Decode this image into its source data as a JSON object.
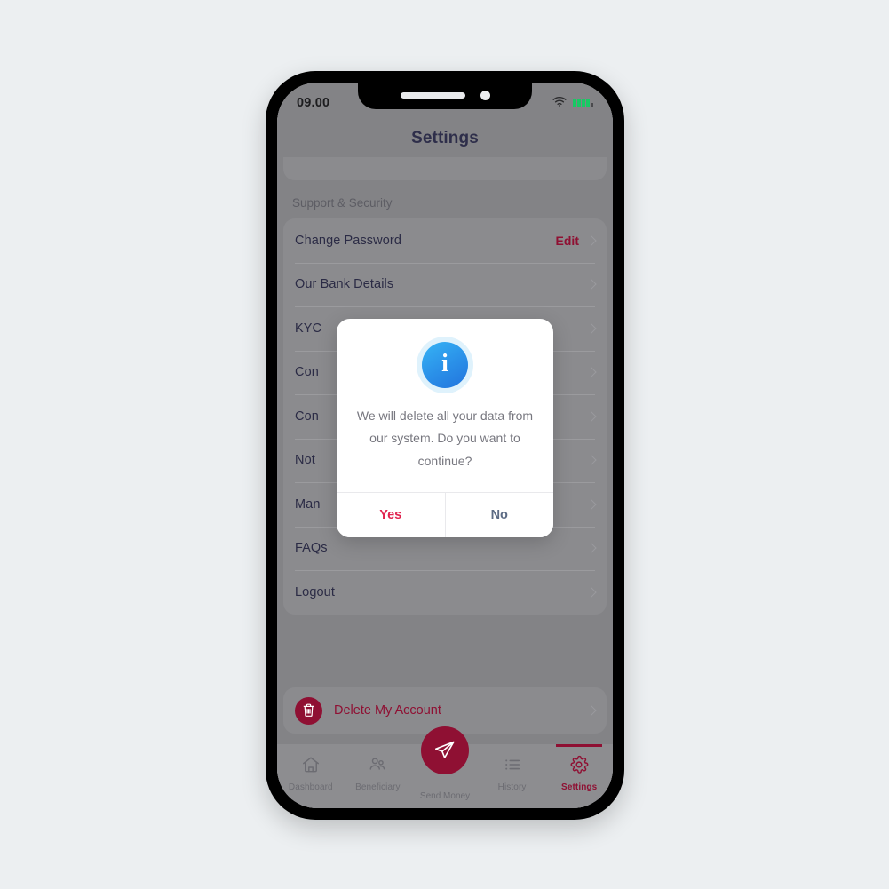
{
  "page": {
    "background_color": "#eceff1"
  },
  "phone": {
    "status_bar": {
      "time": "09.00",
      "wifi_icon": "wifi-icon",
      "battery_icon": "battery-icon",
      "battery_color": "#18c964"
    }
  },
  "header": {
    "title": "Settings"
  },
  "content": {
    "section_title": "Support & Security",
    "rows": [
      {
        "label": "Change Password",
        "action": "Edit",
        "chevron": "chevron-right-icon"
      },
      {
        "label": "Our Bank Details",
        "action": "",
        "chevron": "chevron-right-icon"
      },
      {
        "label": "KYC",
        "action": "",
        "chevron": "chevron-right-icon"
      },
      {
        "label": "Con",
        "action": "",
        "chevron": "chevron-right-icon"
      },
      {
        "label": "Con",
        "action": "",
        "chevron": "chevron-right-icon"
      },
      {
        "label": "Not",
        "action": "",
        "chevron": "chevron-right-icon"
      },
      {
        "label": "Man",
        "action": "",
        "chevron": "chevron-right-icon"
      },
      {
        "label": "FAQs",
        "action": "",
        "chevron": "chevron-right-icon"
      },
      {
        "label": "Logout",
        "action": "",
        "chevron": "chevron-right-icon"
      }
    ]
  },
  "delete_account": {
    "label": "Delete My Account",
    "icon": "trash-icon",
    "chevron": "chevron-right-icon",
    "accent_color": "#8f1033"
  },
  "bottom_nav": {
    "items": [
      {
        "label": "Dashboard",
        "icon": "home-icon",
        "active": false
      },
      {
        "label": "Beneficiary",
        "icon": "people-icon",
        "active": false
      },
      {
        "label": "History",
        "icon": "list-icon",
        "active": false
      },
      {
        "label": "Settings",
        "icon": "gear-icon",
        "active": true
      }
    ],
    "fab": {
      "label": "Send Money",
      "icon": "send-plane-icon",
      "color": "#8f1033"
    },
    "active_color": "#8f1033",
    "inactive_color": "#6c6c72"
  },
  "modal": {
    "icon": "info-icon",
    "icon_color": "#2a8fe8",
    "message": "We will delete all your data from our system. Do you want to continue?",
    "confirm_label": "Yes",
    "cancel_label": "No",
    "confirm_color": "#e0234e",
    "cancel_color": "#5c6b84"
  }
}
